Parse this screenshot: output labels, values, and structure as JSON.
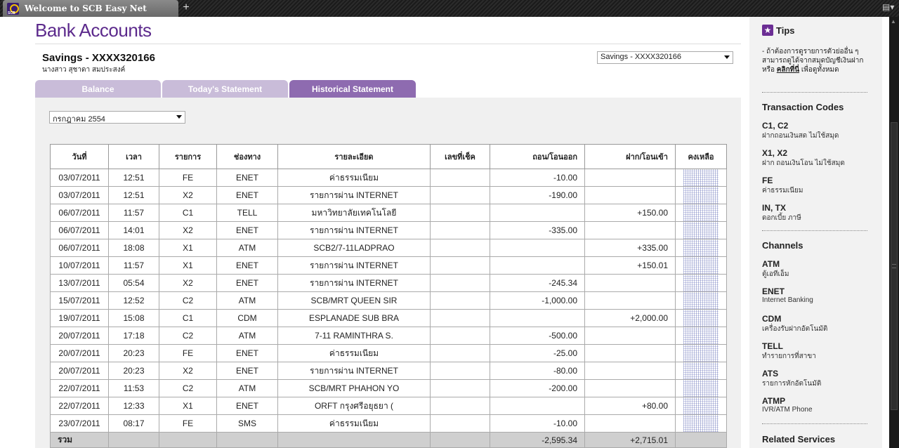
{
  "browser": {
    "tab_title": "Welcome to SCB Easy Net",
    "new_tab": "+"
  },
  "page": {
    "title": "Bank Accounts",
    "account": {
      "name": "Savings - XXXX320166",
      "owner": "นางสาว สุชาดา สมประสงค์",
      "select_value": "Savings - XXXX320166"
    },
    "tabs": [
      "Balance",
      "Today's Statement",
      "Historical Statement"
    ],
    "active_tab": "Historical Statement",
    "month_select": "กรกฎาคม 2554"
  },
  "table": {
    "headers": [
      "วันที่",
      "เวลา",
      "รายการ",
      "ช่องทาง",
      "รายละเอียด",
      "เลขที่เช็ค",
      "ถอน/โอนออก",
      "ฝาก/โอนเข้า",
      "คงเหลือ"
    ],
    "rows": [
      [
        "03/07/2011",
        "12:51",
        "FE",
        "ENET",
        "ค่าธรรมเนียม",
        "",
        "-10.00",
        ""
      ],
      [
        "03/07/2011",
        "12:51",
        "X2",
        "ENET",
        "รายการผ่าน INTERNET",
        "",
        "-190.00",
        ""
      ],
      [
        "06/07/2011",
        "11:57",
        "C1",
        "TELL",
        "มหาวิทยาลัยเทคโนโลยี",
        "",
        "",
        "+150.00"
      ],
      [
        "06/07/2011",
        "14:01",
        "X2",
        "ENET",
        "รายการผ่าน INTERNET",
        "",
        "-335.00",
        ""
      ],
      [
        "06/07/2011",
        "18:08",
        "X1",
        "ATM",
        "SCB2/7-11LADPRAO",
        "",
        "",
        "+335.00"
      ],
      [
        "10/07/2011",
        "11:57",
        "X1",
        "ENET",
        "รายการผ่าน INTERNET",
        "",
        "",
        "+150.01"
      ],
      [
        "13/07/2011",
        "05:54",
        "X2",
        "ENET",
        "รายการผ่าน INTERNET",
        "",
        "-245.34",
        ""
      ],
      [
        "15/07/2011",
        "12:52",
        "C2",
        "ATM",
        "SCB/MRT QUEEN SIR",
        "",
        "-1,000.00",
        ""
      ],
      [
        "19/07/2011",
        "15:08",
        "C1",
        "CDM",
        "ESPLANADE SUB BRA",
        "",
        "",
        "+2,000.00"
      ],
      [
        "20/07/2011",
        "17:18",
        "C2",
        "ATM",
        "7-11 RAMINTHRA S.",
        "",
        "-500.00",
        ""
      ],
      [
        "20/07/2011",
        "20:23",
        "FE",
        "ENET",
        "ค่าธรรมเนียม",
        "",
        "-25.00",
        ""
      ],
      [
        "20/07/2011",
        "20:23",
        "X2",
        "ENET",
        "รายการผ่าน INTERNET",
        "",
        "-80.00",
        ""
      ],
      [
        "22/07/2011",
        "11:53",
        "C2",
        "ATM",
        "SCB/MRT PHAHON YO",
        "",
        "-200.00",
        ""
      ],
      [
        "22/07/2011",
        "12:33",
        "X1",
        "ENET",
        "ORFT กรุงศรีอยุธยา (",
        "",
        "",
        "+80.00"
      ],
      [
        "23/07/2011",
        "08:17",
        "FE",
        "SMS",
        "ค่าธรรมเนียม",
        "",
        "-10.00",
        ""
      ]
    ],
    "total": {
      "label": "รวม",
      "withdraw": "-2,595.34",
      "deposit": "+2,715.01"
    }
  },
  "sidebar": {
    "tips_title": "Tips",
    "tips_text_a": "- ถ้าต้องการดูรายการตัวย่ออื่น ๆ สามารถดูได้จากสมุดบัญชีเงินฝาก หรือ",
    "tips_link": "คลิกที่นี่",
    "tips_text_b": "เพื่อดูทั้งหมด",
    "codes_title": "Transaction Codes",
    "codes": [
      {
        "k": "C1, C2",
        "v": "ฝากถอนเงินสด ไม่ใช้สมุด"
      },
      {
        "k": "X1, X2",
        "v": "ฝาก ถอนเงินโอน ไม่ใช้สมุด"
      },
      {
        "k": "FE",
        "v": "ค่าธรรมเนียม"
      },
      {
        "k": "IN, TX",
        "v": "ดอกเบี้ย ภาษี"
      }
    ],
    "channels_title": "Channels",
    "channels": [
      {
        "k": "ATM",
        "v": "ตู้เอทีเอ็ม"
      },
      {
        "k": "ENET",
        "v": "Internet Banking"
      },
      {
        "k": "CDM",
        "v": "เครื่องรับฝากอัตโนมัติ"
      },
      {
        "k": "TELL",
        "v": "ทำรายการที่สาขา"
      },
      {
        "k": "ATS",
        "v": "รายการหักอัตโนมัติ"
      },
      {
        "k": "ATMP",
        "v": "IVR/ATM Phone"
      }
    ],
    "related_title": "Related Services"
  }
}
